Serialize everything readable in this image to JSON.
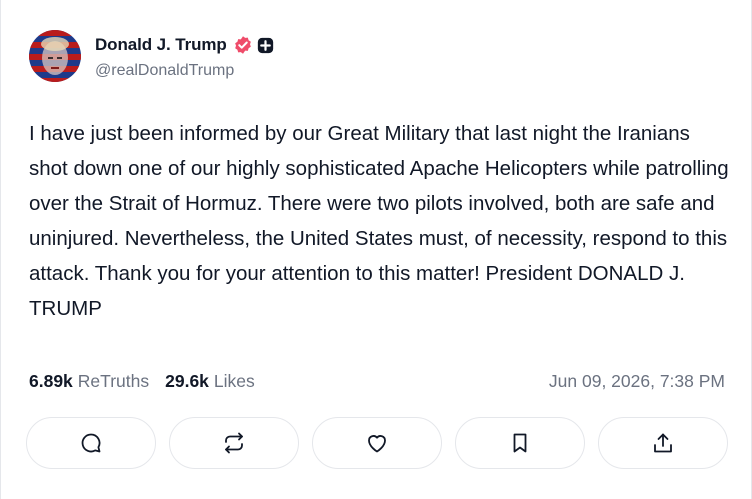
{
  "post": {
    "author": {
      "display_name": "Donald J. Trump",
      "handle": "@realDonaldTrump",
      "verified_icon": "verified-badge-icon",
      "plus_icon": "plus-badge-icon",
      "verified_color": "#ef4c6a"
    },
    "text": "I have just been informed by our Great Military that last night the Iranians shot down one of our highly sophisticated Apache Helicopters while patrolling over the Strait of Hormuz. There were two pilots involved, both are safe and uninjured. Nevertheless, the United States must, of necessity, respond to this attack. Thank you for your attention to this matter! President DONALD J. TRUMP",
    "stats": {
      "retruths_count": "6.89k",
      "retruths_label": "ReTruths",
      "likes_count": "29.6k",
      "likes_label": "Likes"
    },
    "timestamp": "Jun 09, 2026, 7:38 PM",
    "actions": [
      {
        "name": "reply",
        "icon": "comment-icon"
      },
      {
        "name": "retruth",
        "icon": "repost-icon"
      },
      {
        "name": "like",
        "icon": "heart-icon"
      },
      {
        "name": "bookmark",
        "icon": "bookmark-icon"
      },
      {
        "name": "share",
        "icon": "share-icon"
      }
    ]
  }
}
